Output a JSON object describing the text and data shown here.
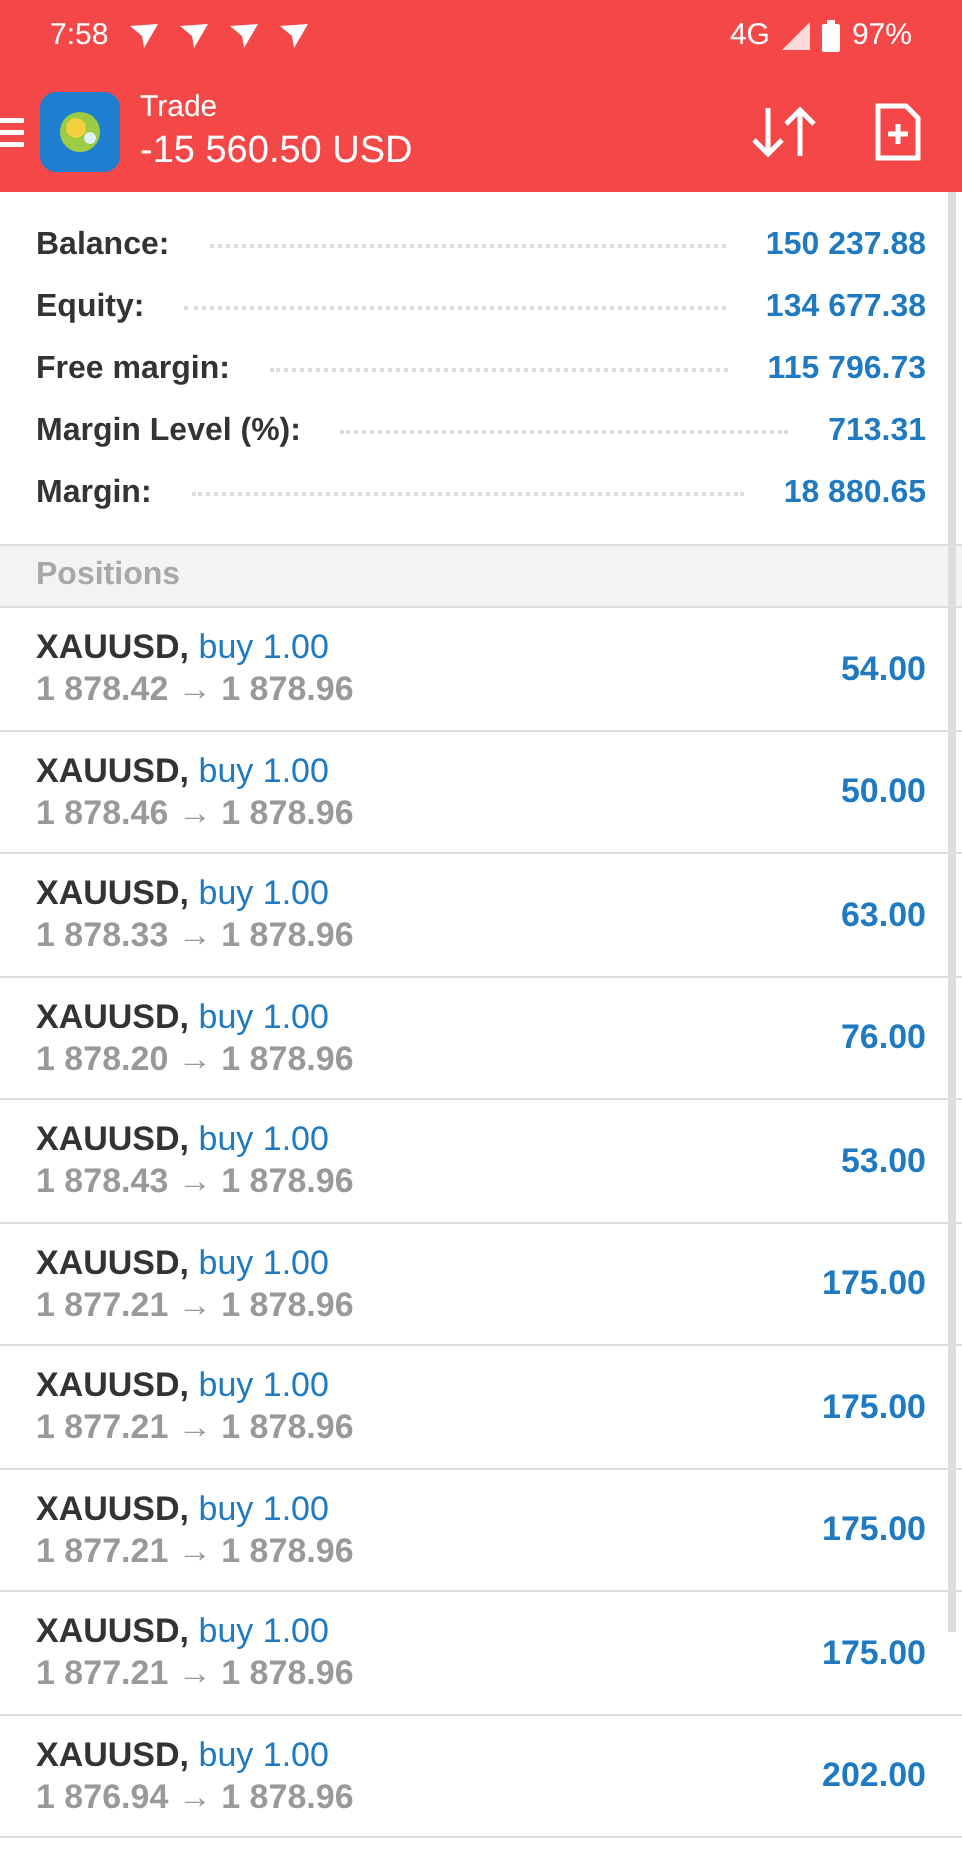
{
  "status_bar": {
    "time": "7:58",
    "network": "4G",
    "battery": "97%"
  },
  "header": {
    "title": "Trade",
    "balance": "-15 560.50 USD"
  },
  "summary": [
    {
      "label": "Balance:",
      "value": "150 237.88"
    },
    {
      "label": "Equity:",
      "value": "134 677.38"
    },
    {
      "label": "Free margin:",
      "value": "115 796.73"
    },
    {
      "label": "Margin Level (%):",
      "value": "713.31"
    },
    {
      "label": "Margin:",
      "value": "18 880.65"
    }
  ],
  "positions_header": "Positions",
  "positions": [
    {
      "symbol": "XAUUSD,",
      "side": "buy 1.00",
      "prices": "1 878.42 → 1 878.96",
      "profit": "54.00"
    },
    {
      "symbol": "XAUUSD,",
      "side": "buy 1.00",
      "prices": "1 878.46 → 1 878.96",
      "profit": "50.00"
    },
    {
      "symbol": "XAUUSD,",
      "side": "buy 1.00",
      "prices": "1 878.33 → 1 878.96",
      "profit": "63.00"
    },
    {
      "symbol": "XAUUSD,",
      "side": "buy 1.00",
      "prices": "1 878.20 → 1 878.96",
      "profit": "76.00"
    },
    {
      "symbol": "XAUUSD,",
      "side": "buy 1.00",
      "prices": "1 878.43 → 1 878.96",
      "profit": "53.00"
    },
    {
      "symbol": "XAUUSD,",
      "side": "buy 1.00",
      "prices": "1 877.21 → 1 878.96",
      "profit": "175.00"
    },
    {
      "symbol": "XAUUSD,",
      "side": "buy 1.00",
      "prices": "1 877.21 → 1 878.96",
      "profit": "175.00"
    },
    {
      "symbol": "XAUUSD,",
      "side": "buy 1.00",
      "prices": "1 877.21 → 1 878.96",
      "profit": "175.00"
    },
    {
      "symbol": "XAUUSD,",
      "side": "buy 1.00",
      "prices": "1 877.21 → 1 878.96",
      "profit": "175.00"
    },
    {
      "symbol": "XAUUSD,",
      "side": "buy 1.00",
      "prices": "1 876.94 → 1 878.96",
      "profit": "202.00"
    }
  ]
}
